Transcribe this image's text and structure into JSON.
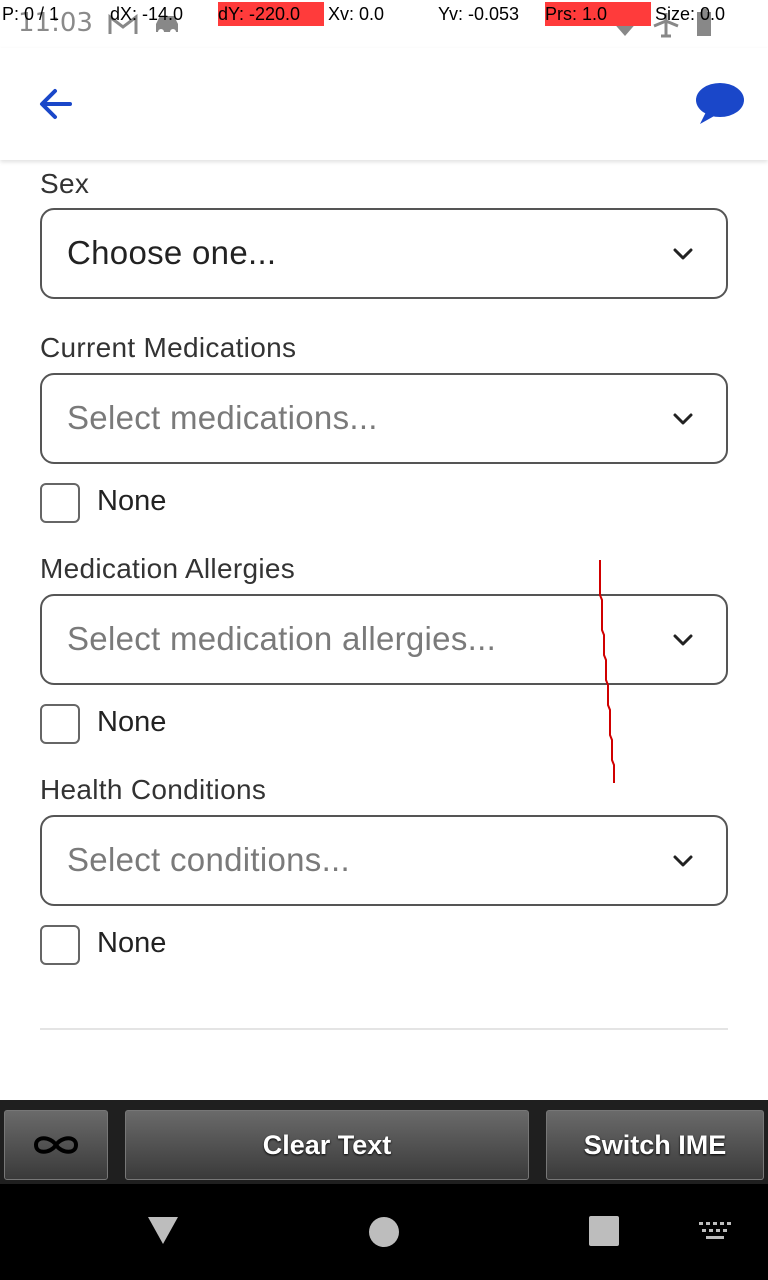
{
  "status_bar": {
    "time": "11:03",
    "icons": [
      "gmail-icon",
      "car-icon",
      "wifi-icon",
      "airplane-icon",
      "battery-icon"
    ]
  },
  "pointer_overlay": {
    "p": "P: 0 / 1",
    "dx": "dX: -14.0",
    "dy": "dY: -220.0",
    "xv": "Xv: 0.0",
    "yv": "Yv: -0.053",
    "prs": "Prs: 1.0",
    "size": "Size: 0.0"
  },
  "header": {
    "back_icon": "arrow-left-icon",
    "chat_icon": "chat-bubble-icon",
    "accent": "#1a47c9"
  },
  "form": {
    "sex": {
      "label": "Sex",
      "value": "Choose one..."
    },
    "medications": {
      "label": "Current Medications",
      "placeholder": "Select medications...",
      "none_label": "None",
      "none_checked": false
    },
    "allergies": {
      "label": "Medication Allergies",
      "placeholder": "Select medication allergies...",
      "none_label": "None",
      "none_checked": false
    },
    "conditions": {
      "label": "Health Conditions",
      "placeholder": "Select conditions...",
      "none_label": "None",
      "none_checked": false
    }
  },
  "ime_bar": {
    "link_icon": "infinity-icon",
    "clear_text": "Clear Text",
    "switch_ime": "Switch IME"
  },
  "nav_bar": {
    "icons": [
      "back-triangle-icon",
      "home-circle-icon",
      "recents-square-icon",
      "keyboard-icon"
    ]
  },
  "colors": {
    "overlay_highlight": "#ff3b3b",
    "trace": "#d00000"
  }
}
